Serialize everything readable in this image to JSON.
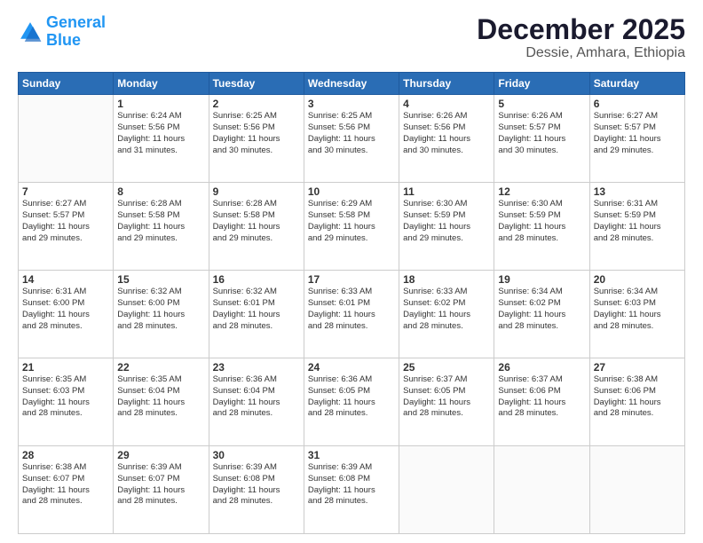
{
  "logo": {
    "line1": "General",
    "line2": "Blue"
  },
  "title": "December 2025",
  "subtitle": "Dessie, Amhara, Ethiopia",
  "days_of_week": [
    "Sunday",
    "Monday",
    "Tuesday",
    "Wednesday",
    "Thursday",
    "Friday",
    "Saturday"
  ],
  "weeks": [
    [
      {
        "day": "",
        "content": ""
      },
      {
        "day": "1",
        "content": "Sunrise: 6:24 AM\nSunset: 5:56 PM\nDaylight: 11 hours\nand 31 minutes."
      },
      {
        "day": "2",
        "content": "Sunrise: 6:25 AM\nSunset: 5:56 PM\nDaylight: 11 hours\nand 30 minutes."
      },
      {
        "day": "3",
        "content": "Sunrise: 6:25 AM\nSunset: 5:56 PM\nDaylight: 11 hours\nand 30 minutes."
      },
      {
        "day": "4",
        "content": "Sunrise: 6:26 AM\nSunset: 5:56 PM\nDaylight: 11 hours\nand 30 minutes."
      },
      {
        "day": "5",
        "content": "Sunrise: 6:26 AM\nSunset: 5:57 PM\nDaylight: 11 hours\nand 30 minutes."
      },
      {
        "day": "6",
        "content": "Sunrise: 6:27 AM\nSunset: 5:57 PM\nDaylight: 11 hours\nand 29 minutes."
      }
    ],
    [
      {
        "day": "7",
        "content": "Sunrise: 6:27 AM\nSunset: 5:57 PM\nDaylight: 11 hours\nand 29 minutes."
      },
      {
        "day": "8",
        "content": "Sunrise: 6:28 AM\nSunset: 5:58 PM\nDaylight: 11 hours\nand 29 minutes."
      },
      {
        "day": "9",
        "content": "Sunrise: 6:28 AM\nSunset: 5:58 PM\nDaylight: 11 hours\nand 29 minutes."
      },
      {
        "day": "10",
        "content": "Sunrise: 6:29 AM\nSunset: 5:58 PM\nDaylight: 11 hours\nand 29 minutes."
      },
      {
        "day": "11",
        "content": "Sunrise: 6:30 AM\nSunset: 5:59 PM\nDaylight: 11 hours\nand 29 minutes."
      },
      {
        "day": "12",
        "content": "Sunrise: 6:30 AM\nSunset: 5:59 PM\nDaylight: 11 hours\nand 28 minutes."
      },
      {
        "day": "13",
        "content": "Sunrise: 6:31 AM\nSunset: 5:59 PM\nDaylight: 11 hours\nand 28 minutes."
      }
    ],
    [
      {
        "day": "14",
        "content": "Sunrise: 6:31 AM\nSunset: 6:00 PM\nDaylight: 11 hours\nand 28 minutes."
      },
      {
        "day": "15",
        "content": "Sunrise: 6:32 AM\nSunset: 6:00 PM\nDaylight: 11 hours\nand 28 minutes."
      },
      {
        "day": "16",
        "content": "Sunrise: 6:32 AM\nSunset: 6:01 PM\nDaylight: 11 hours\nand 28 minutes."
      },
      {
        "day": "17",
        "content": "Sunrise: 6:33 AM\nSunset: 6:01 PM\nDaylight: 11 hours\nand 28 minutes."
      },
      {
        "day": "18",
        "content": "Sunrise: 6:33 AM\nSunset: 6:02 PM\nDaylight: 11 hours\nand 28 minutes."
      },
      {
        "day": "19",
        "content": "Sunrise: 6:34 AM\nSunset: 6:02 PM\nDaylight: 11 hours\nand 28 minutes."
      },
      {
        "day": "20",
        "content": "Sunrise: 6:34 AM\nSunset: 6:03 PM\nDaylight: 11 hours\nand 28 minutes."
      }
    ],
    [
      {
        "day": "21",
        "content": "Sunrise: 6:35 AM\nSunset: 6:03 PM\nDaylight: 11 hours\nand 28 minutes."
      },
      {
        "day": "22",
        "content": "Sunrise: 6:35 AM\nSunset: 6:04 PM\nDaylight: 11 hours\nand 28 minutes."
      },
      {
        "day": "23",
        "content": "Sunrise: 6:36 AM\nSunset: 6:04 PM\nDaylight: 11 hours\nand 28 minutes."
      },
      {
        "day": "24",
        "content": "Sunrise: 6:36 AM\nSunset: 6:05 PM\nDaylight: 11 hours\nand 28 minutes."
      },
      {
        "day": "25",
        "content": "Sunrise: 6:37 AM\nSunset: 6:05 PM\nDaylight: 11 hours\nand 28 minutes."
      },
      {
        "day": "26",
        "content": "Sunrise: 6:37 AM\nSunset: 6:06 PM\nDaylight: 11 hours\nand 28 minutes."
      },
      {
        "day": "27",
        "content": "Sunrise: 6:38 AM\nSunset: 6:06 PM\nDaylight: 11 hours\nand 28 minutes."
      }
    ],
    [
      {
        "day": "28",
        "content": "Sunrise: 6:38 AM\nSunset: 6:07 PM\nDaylight: 11 hours\nand 28 minutes."
      },
      {
        "day": "29",
        "content": "Sunrise: 6:39 AM\nSunset: 6:07 PM\nDaylight: 11 hours\nand 28 minutes."
      },
      {
        "day": "30",
        "content": "Sunrise: 6:39 AM\nSunset: 6:08 PM\nDaylight: 11 hours\nand 28 minutes."
      },
      {
        "day": "31",
        "content": "Sunrise: 6:39 AM\nSunset: 6:08 PM\nDaylight: 11 hours\nand 28 minutes."
      },
      {
        "day": "",
        "content": ""
      },
      {
        "day": "",
        "content": ""
      },
      {
        "day": "",
        "content": ""
      }
    ]
  ]
}
